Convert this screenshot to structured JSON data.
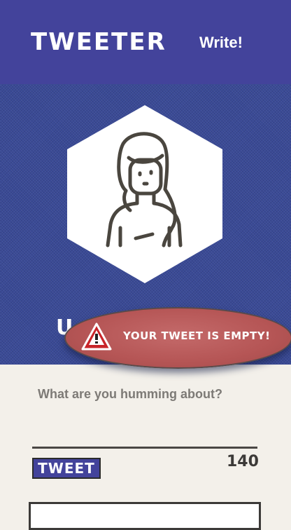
{
  "header": {
    "brand": "TWEETER",
    "write_link": "Write!"
  },
  "hero": {
    "name_visible": "U"
  },
  "toast": {
    "icon": "warning-triangle-icon",
    "message": "YOUR TWEET IS EMPTY!"
  },
  "compose": {
    "placeholder": "What are you humming about?",
    "tweet_button": "TWEET",
    "char_count": "140"
  },
  "colors": {
    "brand": "#43439b",
    "background": "#f3f0ea",
    "toast": "#b55555"
  }
}
